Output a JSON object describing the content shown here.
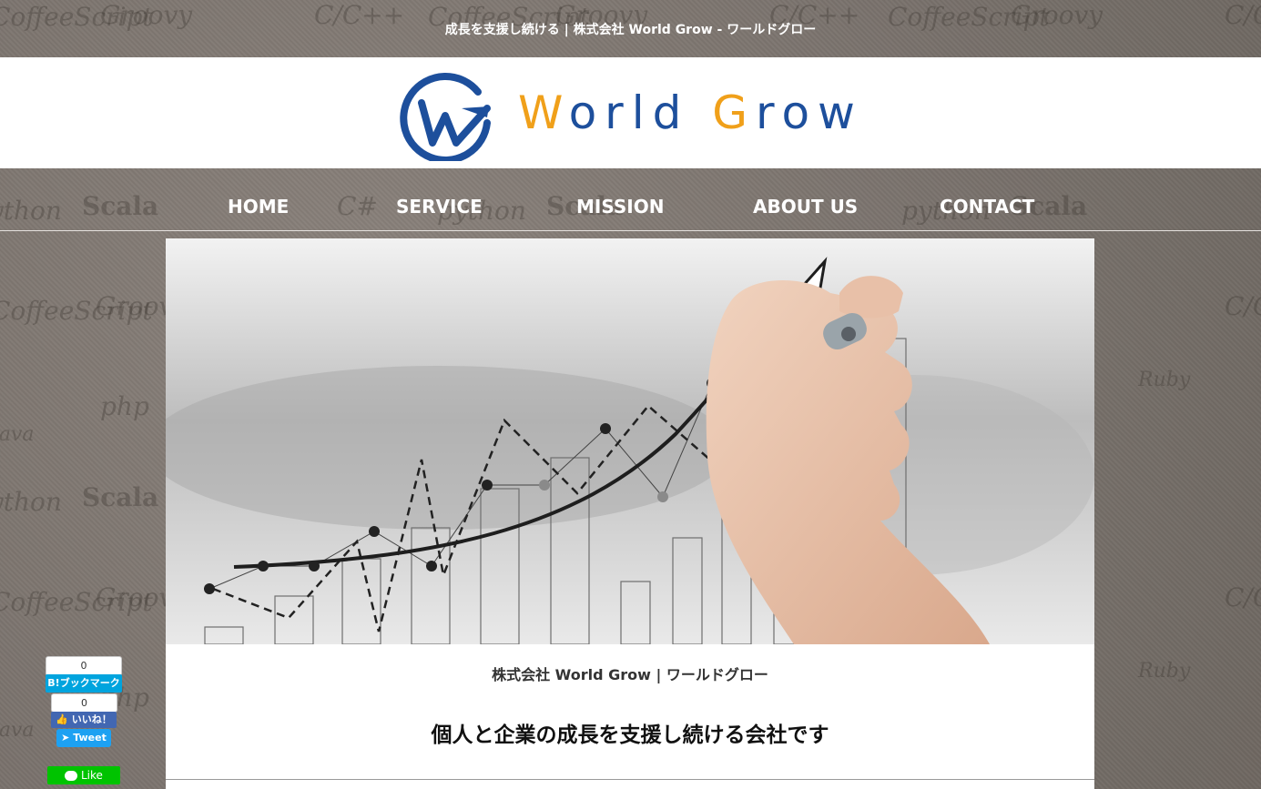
{
  "header": {
    "tagline": "成長を支援し続ける | 株式会社 World Grow - ワールドグロー"
  },
  "logo": {
    "word1_first": "W",
    "word1_rest": "orld ",
    "word2_first": "G",
    "word2_rest": "row",
    "brand_blue": "#1d4f9c",
    "brand_orange": "#f0a01a"
  },
  "nav": {
    "items": [
      {
        "label": "HOME"
      },
      {
        "label": "SERVICE"
      },
      {
        "label": "MISSION"
      },
      {
        "label": "ABOUT US"
      },
      {
        "label": "CONTACT"
      }
    ]
  },
  "background_words": [
    "CoffeeScript",
    "Groovy",
    "C/C++",
    "python",
    "Scala",
    "C#",
    "php",
    "Java",
    "Ruby"
  ],
  "main": {
    "company_name": "株式会社 World Grow | ワールドグロー",
    "headline": "個人と企業の成長を支援し続ける会社です"
  },
  "social": {
    "hatena_count": "0",
    "hatena_label": "B!ブックマーク",
    "fb_count": "0",
    "fb_label": "いいね！",
    "tweet_label": "Tweet",
    "line_label": "Like"
  }
}
